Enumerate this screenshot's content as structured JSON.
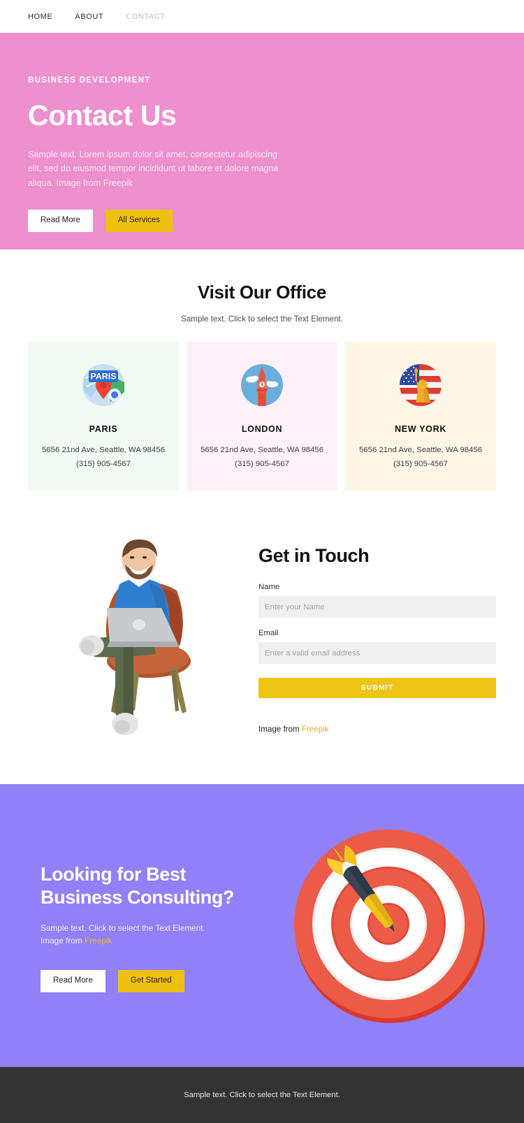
{
  "nav": {
    "items": [
      {
        "label": "HOME",
        "active": true
      },
      {
        "label": "ABOUT",
        "active": true
      },
      {
        "label": "CONTACT",
        "active": false
      }
    ]
  },
  "hero": {
    "eyebrow": "BUSINESS DEVELOPMENT",
    "title": "Contact Us",
    "subtitle": "Sample text. Lorem ipsum dolor sit amet, consectetur adipiscing elit, sed do eiusmod tempor incididunt ut labore et dolore magna aliqua. Image from Freepik",
    "primary_button": "Read More",
    "secondary_button": "All Services",
    "background_color": "#ee8fce"
  },
  "offices": {
    "title": "Visit Our Office",
    "subtitle": "Sample text. Click to select the Text Element.",
    "cards": [
      {
        "city": "PARIS",
        "address": "5656 21nd Ave, Seattle, WA 98456",
        "phone": "(315) 905-4567",
        "icon": "map-pin-paris-icon",
        "background_color": "#f0f9f2",
        "pin_label": "PARIS"
      },
      {
        "city": "LONDON",
        "address": "5656 21nd Ave, Seattle, WA 98456",
        "phone": "(315) 905-4567",
        "icon": "big-ben-london-icon",
        "background_color": "#fdf2fa"
      },
      {
        "city": "NEW YORK",
        "address": "5656 21nd Ave, Seattle, WA 98456",
        "phone": "(315) 905-4567",
        "icon": "statue-of-liberty-icon",
        "background_color": "#fdf6e5"
      }
    ]
  },
  "contact": {
    "title": "Get in Touch",
    "illustration": "man-with-laptop-on-chair-illustration",
    "name_label": "Name",
    "name_placeholder": "Enter your Name",
    "name_value": "",
    "email_label": "Email",
    "email_placeholder": "Enter a valid email address",
    "email_value": "",
    "submit_label": "SUBMIT",
    "credit_prefix": "Image from ",
    "credit_link": "Freepik"
  },
  "cta": {
    "title_line1": "Looking for Best",
    "title_line2": "Business Consulting?",
    "subtitle": "Sample text. Click to select the Text Element.",
    "credit_prefix": "Image from ",
    "credit_link": "Freepik",
    "primary_button": "Read More",
    "secondary_button": "Get Started",
    "background_color": "#9180f7",
    "illustration": "dartboard-with-dart-illustration"
  },
  "footer": {
    "text": "Sample text. Click to select the Text Element.",
    "background_color": "#333333"
  }
}
